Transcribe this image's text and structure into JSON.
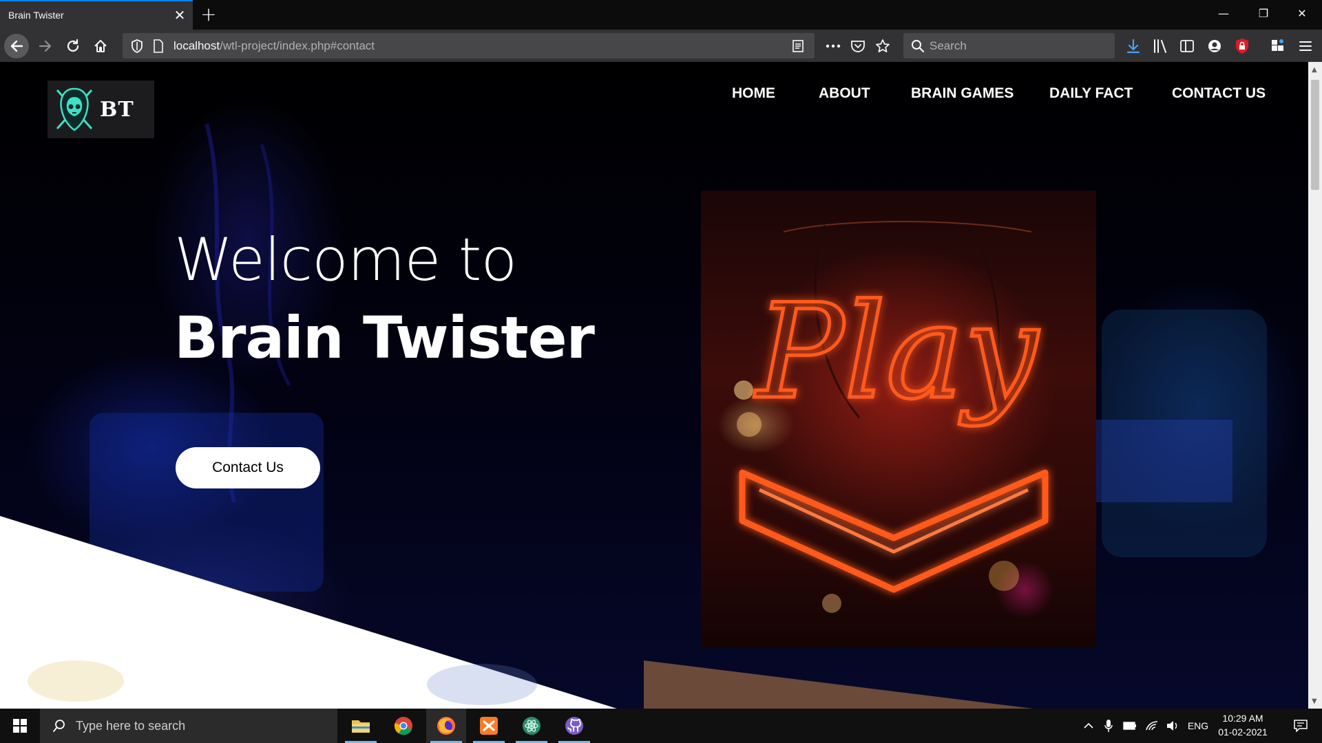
{
  "browser": {
    "tab_title": "Brain Twister",
    "url_host": "localhost",
    "url_path": "/wtl-project/index.php#contact",
    "search_placeholder": "Search"
  },
  "site": {
    "logo_text": "BT",
    "menu": [
      "HOME",
      "ABOUT",
      "BRAIN GAMES",
      "DAILY FACT",
      "CONTACT US"
    ],
    "hero_line1": "Welcome to",
    "hero_line2": "Brain Twister",
    "cta_label": "Contact Us",
    "sign_text": "Play"
  },
  "taskbar": {
    "search_placeholder": "Type here to search",
    "language": "ENG",
    "time": "10:29 AM",
    "date": "01-02-2021"
  },
  "colors": {
    "accent": "#0a84ff",
    "neon": "#ff5a1f",
    "logo_teal": "#3fe0c5"
  }
}
